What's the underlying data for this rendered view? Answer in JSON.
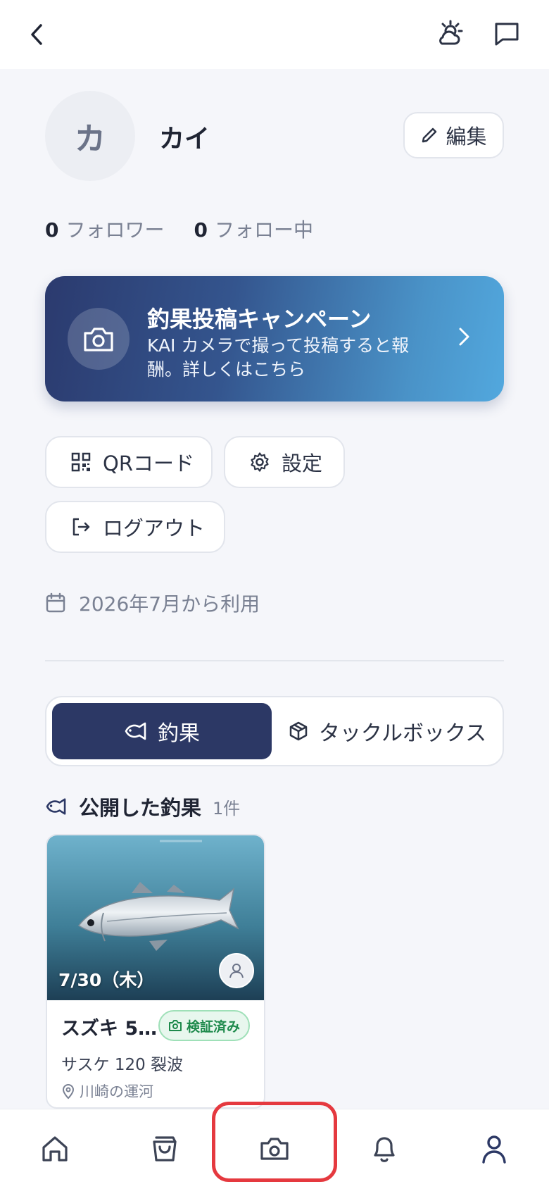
{
  "topbar": {
    "back_icon": "chevron-left-icon",
    "weather_icon": "weather-icon",
    "chat_icon": "chat-bubble-icon"
  },
  "profile": {
    "avatar_initial": "カ",
    "name": "カイ",
    "edit_label": "編集"
  },
  "stats": {
    "followers_count": "0",
    "followers_label": "フォロワー",
    "following_count": "0",
    "following_label": "フォロー中"
  },
  "campaign": {
    "title": "釣果投稿キャンペーン",
    "description": "KAI カメラで撮って投稿すると報酬。詳しくはこちら"
  },
  "actions": {
    "qr_label": "QRコード",
    "settings_label": "設定",
    "logout_label": "ログアウト"
  },
  "member_since": "2026年7月から利用",
  "tabs": {
    "catches": "釣果",
    "tacklebox": "タックルボックス"
  },
  "section": {
    "title": "公開した釣果",
    "count": "1件"
  },
  "catch_card": {
    "date": "7/30（木）",
    "title": "スズキ 5…",
    "badge": "検証済み",
    "tackle": "サスケ 120 裂波",
    "place": "川崎の運河"
  },
  "nav": {
    "items": [
      "home-icon",
      "shopping-bag-icon",
      "camera-icon",
      "bell-icon",
      "user-icon"
    ]
  },
  "colors": {
    "primary": "#2c3865",
    "verified": "#1e8a4c",
    "highlight": "#e5393f"
  }
}
